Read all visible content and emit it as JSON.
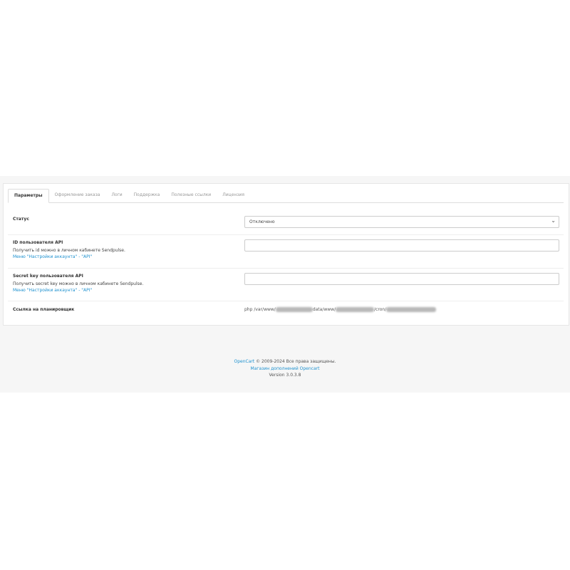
{
  "tabs": [
    {
      "label": "Параметры",
      "active": true
    },
    {
      "label": "Оформление заказа",
      "active": false
    },
    {
      "label": "Логи",
      "active": false
    },
    {
      "label": "Поддержка",
      "active": false
    },
    {
      "label": "Полезные ссылки",
      "active": false
    },
    {
      "label": "Лицензия",
      "active": false
    }
  ],
  "form": {
    "status": {
      "label": "Статус",
      "value": "Отключено"
    },
    "api_id": {
      "label": "ID пользователя API",
      "help": "Получить id можно в личном кабинете Sendpulse.",
      "link": "Меню \"Настройки аккаунта\" - \"API\"",
      "value": ""
    },
    "api_secret": {
      "label": "Secret key пользователя API",
      "help": "Получить secret key можно в личном кабинете Sendpulse.",
      "link": "Меню \"Настройки аккаунта\" - \"API\"",
      "value": ""
    },
    "cron": {
      "label": "Ссылка на планировщик",
      "part1": "php /var/www/",
      "part2": "data/www/",
      "part3": "/cron/"
    }
  },
  "footer": {
    "brand": "OpenCart",
    "copyright": " © 2009-2024 Все права защищены.",
    "store_link": "Магазин дополнений Opencart",
    "version": "Version 3.0.3.8"
  }
}
